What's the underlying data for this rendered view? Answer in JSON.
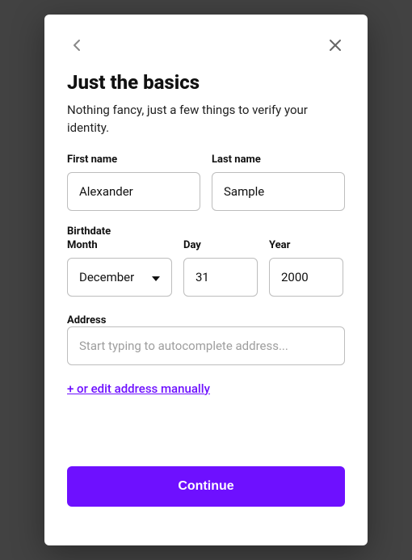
{
  "header": {
    "title": "Just the basics",
    "subtitle": "Nothing fancy, just a few things to verify your identity."
  },
  "fields": {
    "first_name": {
      "label": "First name",
      "value": "Alexander"
    },
    "last_name": {
      "label": "Last name",
      "value": "Sample"
    },
    "birthdate_label": "Birthdate",
    "month": {
      "label": "Month",
      "value": "December"
    },
    "day": {
      "label": "Day",
      "value": "31"
    },
    "year": {
      "label": "Year",
      "value": "2000"
    },
    "address": {
      "label": "Address",
      "placeholder": "Start typing to autocomplete address...",
      "value": ""
    }
  },
  "links": {
    "manual_address": "+ or edit address manually"
  },
  "buttons": {
    "continue": "Continue"
  },
  "icons": {
    "back": "back-icon",
    "close": "close-icon",
    "caret": "chevron-down-icon"
  }
}
